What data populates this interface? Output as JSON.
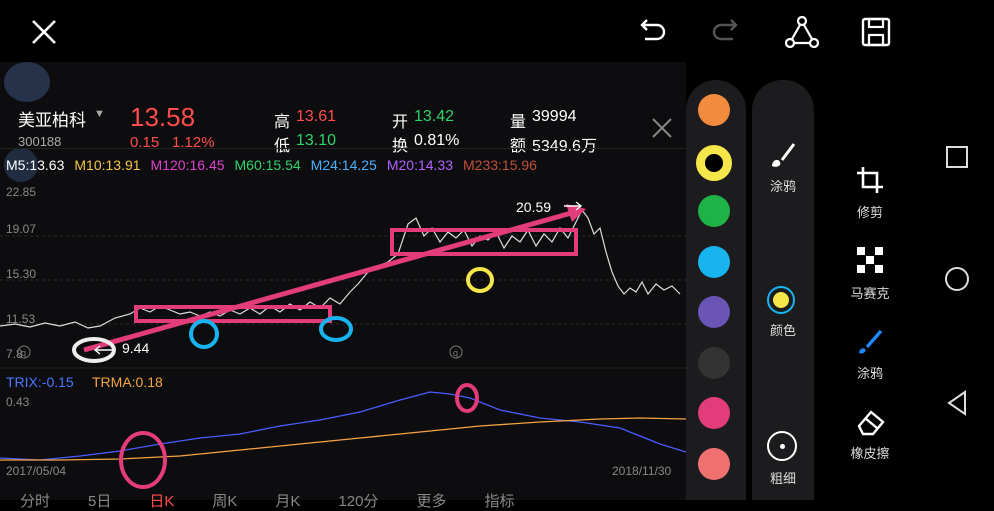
{
  "toolbar": {
    "close_icon": "close-icon",
    "undo_icon": "undo-icon",
    "redo_icon": "redo-icon",
    "share_icon": "share-icon",
    "save_icon": "save-icon"
  },
  "stock": {
    "name": "美亚柏科",
    "code": "300188",
    "price": "13.58",
    "change": "0.15",
    "change_pct": "1.12%",
    "high_label": "高",
    "high": "13.61",
    "low_label": "低",
    "low": "13.10",
    "open_label": "开",
    "open": "13.42",
    "turnover_label": "换",
    "turnover": "0.81%",
    "volume_label": "量",
    "volume": "39994",
    "amount_label": "额",
    "amount": "5349.6万"
  },
  "ma_line": [
    {
      "label": "M5:13.63",
      "color": "#ffffff"
    },
    {
      "label": "M10:13.91",
      "color": "#f5c542"
    },
    {
      "label": "M120:16.45",
      "color": "#e040d0"
    },
    {
      "label": "M60:15.54",
      "color": "#2fd36b"
    },
    {
      "label": "M24:14.25",
      "color": "#4ab0ff"
    },
    {
      "label": "M20:14.33",
      "color": "#b060ff"
    },
    {
      "label": "M233:15.96",
      "color": "#c0503a"
    }
  ],
  "price_axis": [
    "22.85",
    "19.07",
    "15.30",
    "11.53",
    "7.8"
  ],
  "annotations": {
    "high_value": "20.59",
    "low_value": "9.44",
    "q_marker": "q"
  },
  "indicator": {
    "trix_label": "TRIX:-0.15",
    "trma_label": "TRMA:0.18",
    "axis_top": "0.43",
    "date_start": "2017/05/04",
    "date_end": "2018/11/30"
  },
  "bottom_tabs": [
    "分时",
    "5日",
    "日K",
    "周K",
    "月K",
    "120分",
    "更多",
    "指标"
  ],
  "palette": {
    "colors": [
      "#f28b3c",
      "#f5e64a",
      "#1fb347",
      "#17b4f0",
      "#6a55b6",
      "#333333",
      "#e23c7b",
      "#f07070"
    ],
    "selected_index": 1
  },
  "tools": {
    "graffiti": "涂鸦",
    "color": "颜色",
    "thickness": "粗细",
    "crop": "修剪",
    "mosaic": "马赛克",
    "graffiti2": "涂鸦",
    "eraser": "橡皮擦"
  }
}
